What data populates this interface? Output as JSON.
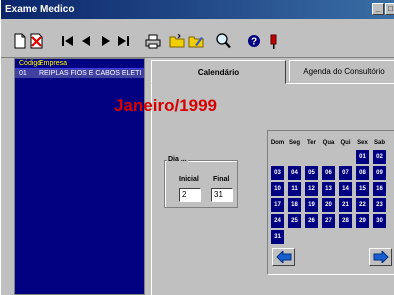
{
  "window": {
    "title": "Exame Medico"
  },
  "left_panel": {
    "columns": [
      "Código",
      "Empresa"
    ],
    "rows": [
      {
        "code": "01",
        "company": "REIPLAS FIOS E CABOS ELETI"
      }
    ]
  },
  "tabs": [
    {
      "label": "Calendário",
      "active": true
    },
    {
      "label": "Agenda do Consultório",
      "active": false
    }
  ],
  "calendar": {
    "month_title": "Janeiro/1999",
    "weekdays": [
      "Dom",
      "Seg",
      "Ter",
      "Qua",
      "Qui",
      "Sex",
      "Sab"
    ],
    "weeks": [
      [
        "",
        "",
        "",
        "",
        "",
        "01",
        "02"
      ],
      [
        "03",
        "04",
        "05",
        "06",
        "07",
        "08",
        "09"
      ],
      [
        "10",
        "11",
        "12",
        "13",
        "14",
        "15",
        "16"
      ],
      [
        "17",
        "18",
        "19",
        "20",
        "21",
        "22",
        "23"
      ],
      [
        "24",
        "25",
        "26",
        "27",
        "28",
        "29",
        "30"
      ],
      [
        "31",
        "",
        "",
        "",
        "",
        "",
        ""
      ]
    ]
  },
  "dia_group": {
    "title": "Dia ...",
    "inicial_label": "Inicial",
    "final_label": "Final",
    "inicial_value": "2",
    "final_value": "31"
  },
  "colors": {
    "accent_red": "#d80000",
    "day_bg": "#000080",
    "titlebar": "#0a246a"
  },
  "toolbar_icons": [
    "new-document-icon",
    "delete-icon",
    "first-record-icon",
    "previous-record-icon",
    "next-record-icon",
    "last-record-icon",
    "print-icon",
    "open-folder-icon",
    "edit-folder-icon",
    "search-icon",
    "help-icon",
    "exit-icon"
  ]
}
